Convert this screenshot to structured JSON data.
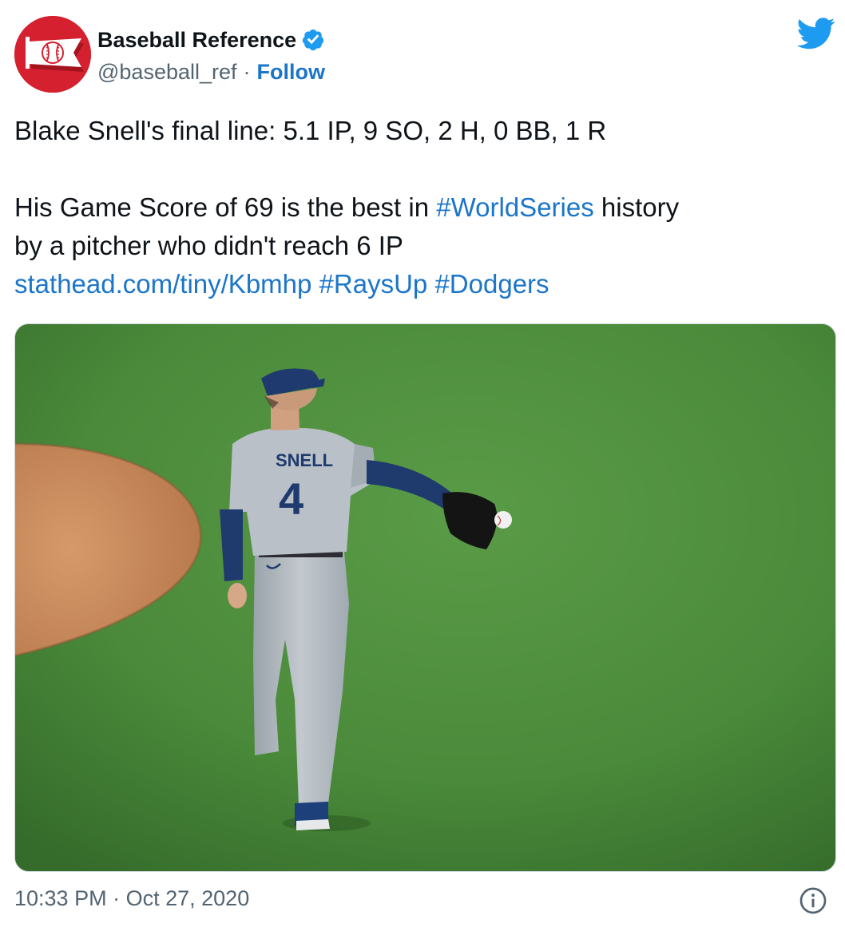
{
  "author": {
    "display_name": "Baseball Reference",
    "handle": "@baseball_ref",
    "separator": "·",
    "follow_label": "Follow",
    "verified": true,
    "brand_color": "#d4202f"
  },
  "tweet": {
    "line1": "Blake Snell's final line: 5.1 IP, 9 SO, 2 H, 0 BB, 1 R",
    "line2_pre": "His Game Score of 69 is the best in ",
    "hashtag_worldseries": "#WorldSeries",
    "line2_post": " history",
    "line3": "by a pitcher who didn't reach 6 IP",
    "url": "stathead.com/tiny/Kbmhp",
    "hashtag_raysup": "#RaysUp",
    "hashtag_dodgers": "#Dodgers"
  },
  "media": {
    "jersey_name": "SNELL",
    "jersey_number": "4"
  },
  "footer": {
    "time": "10:33 PM",
    "separator": "·",
    "date": "Oct 27, 2020"
  },
  "icons": {
    "twitter": "twitter-bird-icon",
    "verified": "verified-badge-icon",
    "info": "info-icon"
  },
  "colors": {
    "link": "#1b75c9",
    "twitter_blue": "#1d9bf0",
    "secondary_text": "#536471"
  }
}
